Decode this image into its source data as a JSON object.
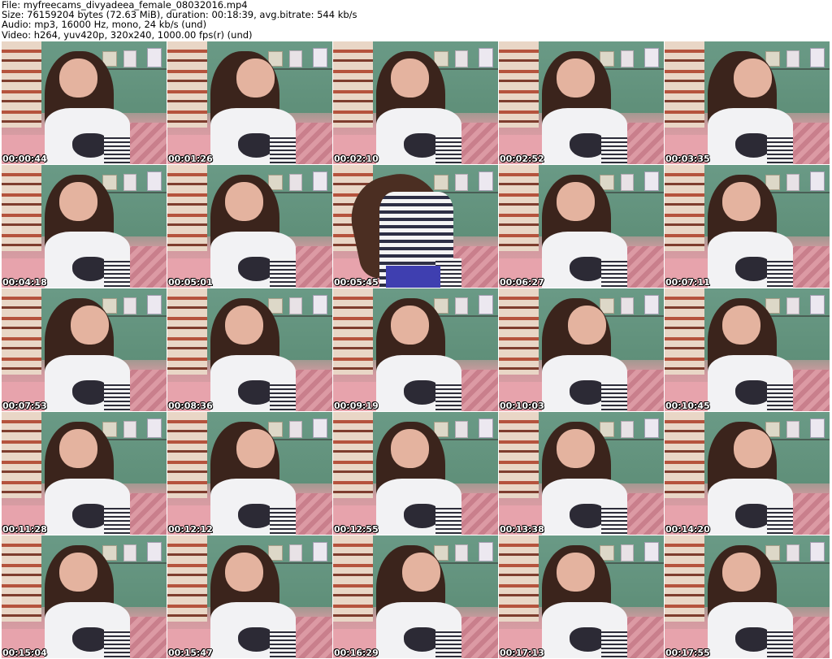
{
  "header": {
    "file_line": "File: myfreecams_divyadeea_female_08032016.mp4",
    "size_line": "Size: 76159204 bytes (72.63 MiB), duration: 00:18:39, avg.bitrate: 544 kb/s",
    "audio_line": "Audio: mp3, 16000 Hz, mono, 24 kb/s (und)",
    "video_line": "Video: h264, yuv420p, 320x240, 1000.00 fps(r) (und)"
  },
  "thumbnails": [
    {
      "timestamp": "00:00:44",
      "variant": "normal"
    },
    {
      "timestamp": "00:01:26",
      "variant": "normal"
    },
    {
      "timestamp": "00:02:10",
      "variant": "normal"
    },
    {
      "timestamp": "00:02:52",
      "variant": "normal"
    },
    {
      "timestamp": "00:03:35",
      "variant": "normal"
    },
    {
      "timestamp": "00:04:18",
      "variant": "normal"
    },
    {
      "timestamp": "00:05:01",
      "variant": "normal"
    },
    {
      "timestamp": "00:05:45",
      "variant": "motion"
    },
    {
      "timestamp": "00:06:27",
      "variant": "normal"
    },
    {
      "timestamp": "00:07:11",
      "variant": "normal"
    },
    {
      "timestamp": "00:07:53",
      "variant": "normal"
    },
    {
      "timestamp": "00:08:36",
      "variant": "normal"
    },
    {
      "timestamp": "00:09:19",
      "variant": "normal"
    },
    {
      "timestamp": "00:10:03",
      "variant": "normal"
    },
    {
      "timestamp": "00:10:45",
      "variant": "normal"
    },
    {
      "timestamp": "00:11:28",
      "variant": "normal"
    },
    {
      "timestamp": "00:12:12",
      "variant": "normal"
    },
    {
      "timestamp": "00:12:55",
      "variant": "normal"
    },
    {
      "timestamp": "00:13:38",
      "variant": "normal"
    },
    {
      "timestamp": "00:14:20",
      "variant": "normal"
    },
    {
      "timestamp": "00:15:04",
      "variant": "normal"
    },
    {
      "timestamp": "00:15:47",
      "variant": "normal"
    },
    {
      "timestamp": "00:16:29",
      "variant": "normal"
    },
    {
      "timestamp": "00:17:13",
      "variant": "normal"
    },
    {
      "timestamp": "00:17:55",
      "variant": "normal"
    }
  ]
}
